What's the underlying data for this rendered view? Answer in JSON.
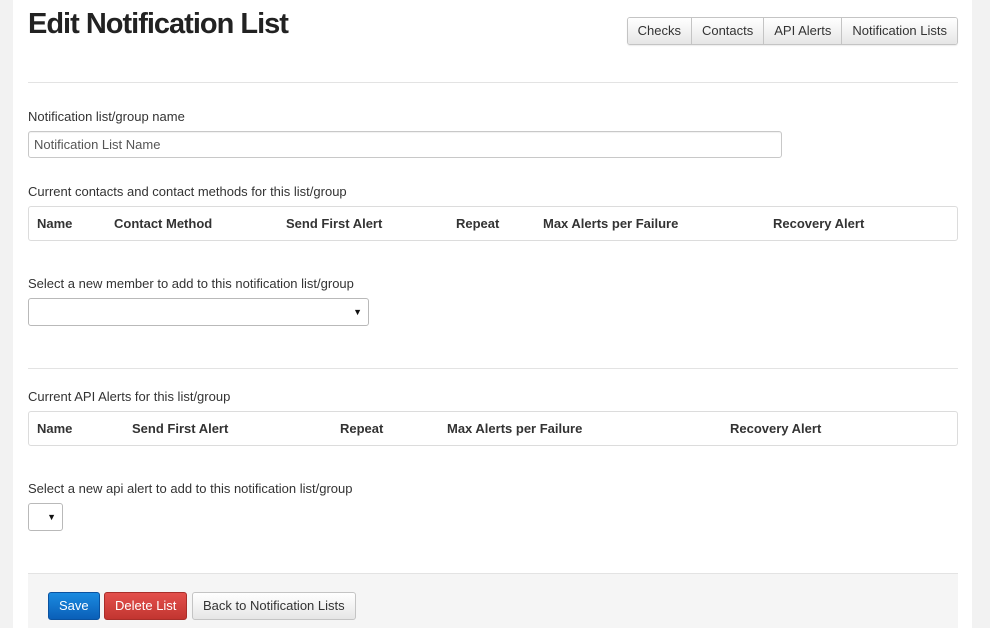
{
  "page": {
    "title": "Edit Notification List"
  },
  "nav": {
    "checks": "Checks",
    "contacts": "Contacts",
    "api_alerts": "API Alerts",
    "notification_lists": "Notification Lists"
  },
  "form": {
    "name_label": "Notification list/group name",
    "name_placeholder": "Notification List Name",
    "name_value": "",
    "contacts_label": "Current contacts and contact methods for this list/group",
    "contacts_columns": [
      "Name",
      "Contact Method",
      "Send First Alert",
      "Repeat",
      "Max Alerts per Failure",
      "Recovery Alert"
    ],
    "member_label": "Select a new member to add to this notification list/group",
    "member_selected": "",
    "api_label": "Current API Alerts for this list/group",
    "api_columns": [
      "Name",
      "Send First Alert",
      "Repeat",
      "Max Alerts per Failure",
      "Recovery Alert"
    ],
    "api_select_label": "Select a new api alert to add to this notification list/group",
    "api_selected": ""
  },
  "footer": {
    "save": "Save",
    "delete": "Delete List",
    "back": "Back to Notification Lists"
  },
  "icons": {
    "dropdown": "▼"
  },
  "colors": {
    "save": "#1577d2",
    "delete": "#d2413c"
  }
}
